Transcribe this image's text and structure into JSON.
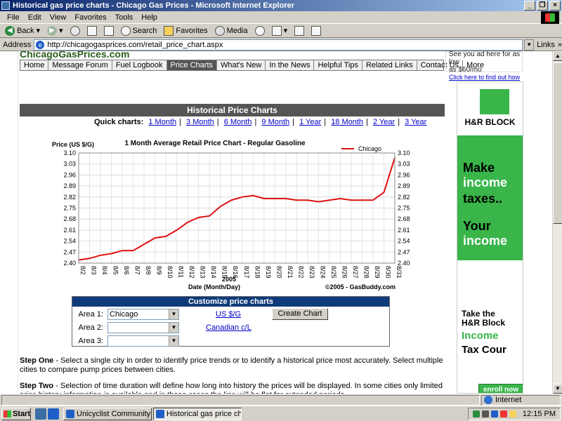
{
  "window": {
    "title": "Historical gas price charts - Chicago Gas Prices - Microsoft Internet Explorer"
  },
  "menu": [
    "File",
    "Edit",
    "View",
    "Favorites",
    "Tools",
    "Help"
  ],
  "toolbar": {
    "back": "Back",
    "search": "Search",
    "favorites": "Favorites",
    "media": "Media"
  },
  "address": {
    "label": "Address",
    "url": "http://chicagogasprices.com/retail_price_chart.aspx",
    "links": "Links"
  },
  "site": {
    "nav": [
      "Home",
      "Message Forum",
      "Fuel Logbook",
      "Price Charts",
      "What's New",
      "In the News",
      "Helpful Tips",
      "Related Links",
      "Contact Us",
      "More"
    ],
    "active_nav": "Price Charts",
    "section_title": "Historical Price Charts",
    "quick_label": "Quick charts:",
    "quick_links": [
      "1 Month",
      "3 Month",
      "6 Month",
      "9 Month",
      "1 Year",
      "18 Month",
      "2 Year",
      "3 Year"
    ]
  },
  "ads": {
    "top_text1": "See you ad here for as low",
    "top_text2": "as $60/mo",
    "top_link": "Click here to find out how",
    "hr_name": "H&R BLOCK",
    "hr_make": "Make",
    "hr_income": "income",
    "hr_taxes": "taxes..",
    "hr_your": "Your",
    "hr_income2": "income",
    "hr_take": "Take the",
    "hr_block": "H&R Block",
    "hr_income3": "Income",
    "hr_taxcour": "Tax Cour",
    "hr_enroll": "enroll now"
  },
  "chart_data": {
    "type": "line",
    "title": "1 Month Average Retail Price Chart - Regular Gasoline",
    "ylabel": "Price (US $/G)",
    "xlabel": "Date (Month/Day)",
    "xsublabel": "2005",
    "credit": "©2005 - GasBuddy.com",
    "ylim": [
      2.4,
      3.1
    ],
    "yticks": [
      "3.10",
      "3.03",
      "2.96",
      "2.89",
      "2.82",
      "2.75",
      "2.68",
      "2.61",
      "2.54",
      "2.47",
      "2.40"
    ],
    "categories": [
      "8/2",
      "8/3",
      "8/4",
      "8/5",
      "8/6",
      "8/7",
      "8/8",
      "8/9",
      "8/10",
      "8/11",
      "8/12",
      "8/13",
      "8/14",
      "8/15",
      "8/16",
      "8/17",
      "8/18",
      "8/19",
      "8/20",
      "8/21",
      "8/22",
      "8/23",
      "8/24",
      "8/25",
      "8/26",
      "8/27",
      "8/28",
      "8/29",
      "8/30",
      "8/31"
    ],
    "series": [
      {
        "name": "Chicago",
        "color": "#e01010",
        "values": [
          2.42,
          2.43,
          2.45,
          2.46,
          2.48,
          2.48,
          2.52,
          2.56,
          2.57,
          2.61,
          2.66,
          2.69,
          2.7,
          2.76,
          2.8,
          2.82,
          2.83,
          2.81,
          2.81,
          2.81,
          2.8,
          2.8,
          2.79,
          2.8,
          2.81,
          2.8,
          2.8,
          2.8,
          2.85,
          3.07
        ]
      }
    ],
    "legend": "top-right",
    "grid": true
  },
  "customize": {
    "title": "Customize price charts",
    "area1_label": "Area 1:",
    "area2_label": "Area 2:",
    "area3_label": "Area 3:",
    "area1_value": "Chicago",
    "usd_link": "US $/G",
    "cad_link": "Canadian c/L",
    "create_button": "Create Chart"
  },
  "steps": {
    "one_label": "Step One",
    "one_text": " - Select a single city in order to identify price trends or to identify a historical price most accurately. Select multiple cities to compare pump prices between cities.",
    "two_label": "Step Two",
    "two_text": " - Selection of time duration will define how long into history the prices will be displayed. In some cities only limited price history information is available and in those cases the line will be flat for extended periods."
  },
  "status": {
    "zone": "Internet"
  },
  "taskbar": {
    "start": "Start",
    "task1": "Unicyclist Community For...",
    "task2": "Historical gas price charts...",
    "clock": "12:15 PM"
  }
}
